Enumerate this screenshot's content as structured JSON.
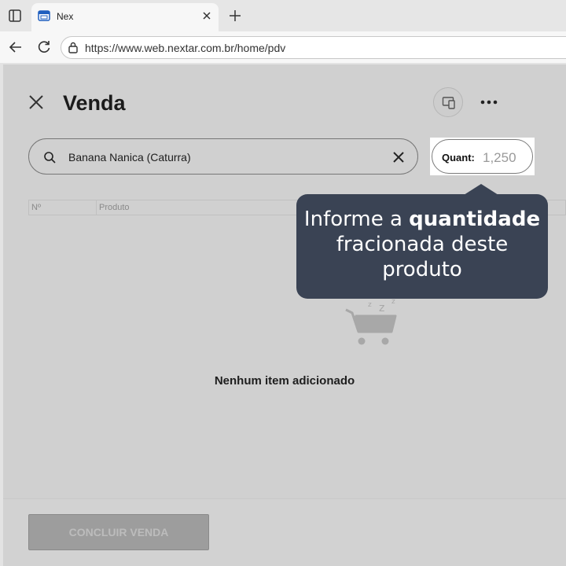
{
  "browser": {
    "tab_title": "Nex",
    "url": "https://www.web.nextar.com.br/home/pdv"
  },
  "page": {
    "title": "Venda",
    "search_value": "Banana Nanica (Caturra)",
    "quantity_label": "Quant:",
    "quantity_value": "1,250",
    "table_headers": [
      "Nº",
      "Produto"
    ],
    "empty_message": "Nenhum item adicionado",
    "finish_button": "CONCLUIR VENDA"
  },
  "tooltip": {
    "prefix": "Informe a ",
    "bold": "quantidade",
    "line2": "fracionada deste",
    "line3": "produto"
  },
  "colors": {
    "tooltip_bg": "#3a4354",
    "page_overlay": "#d0d0d0"
  }
}
